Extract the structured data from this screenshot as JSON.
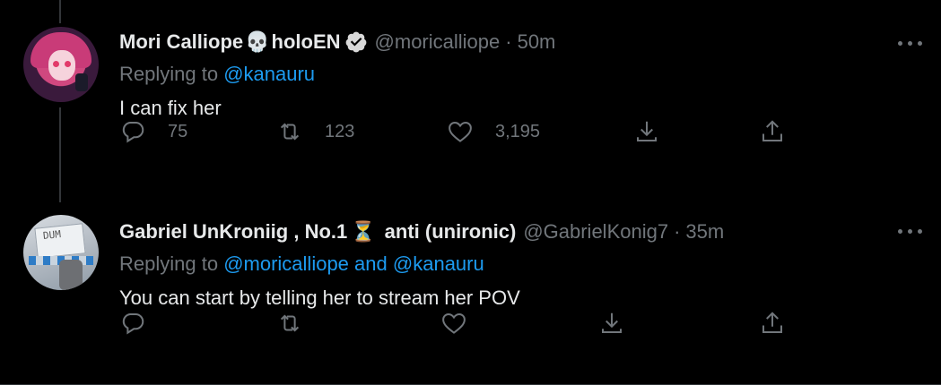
{
  "tweets": [
    {
      "display_name": "Mori Calliope",
      "name_emoji": "💀",
      "name_suffix": "holoEN",
      "verified": true,
      "handle": "@moricalliope",
      "time": "50m",
      "replying_prefix": "Replying to",
      "replying_to": "@kanauru",
      "replying_and": "",
      "replying_to_2": "",
      "text": "I can fix her",
      "stats": {
        "replies": "75",
        "retweets": "123",
        "likes": "3,195"
      }
    },
    {
      "display_name": "Gabriel UnKroniig , No.1",
      "name_emoji": "⏳",
      "name_suffix": "anti (unironic)",
      "verified": false,
      "handle": "@GabrielKonig7",
      "time": "35m",
      "replying_prefix": "Replying to",
      "replying_to": "@moricalliope",
      "replying_and": "and",
      "replying_to_2": "@kanauru",
      "text": "You can start by telling her to stream her POV",
      "stats": {
        "replies": "",
        "retweets": "",
        "likes": ""
      }
    }
  ],
  "avatar_text": "DUM",
  "dot": "·",
  "colors": {
    "background": "#000000",
    "text": "#e7e9ea",
    "muted": "#71767b",
    "link": "#1d9bf0",
    "verified": "#d9d9d9"
  },
  "icons": [
    "reply-icon",
    "retweet-icon",
    "like-icon",
    "share-icon",
    "upload-icon",
    "more-icon",
    "verified-icon"
  ]
}
